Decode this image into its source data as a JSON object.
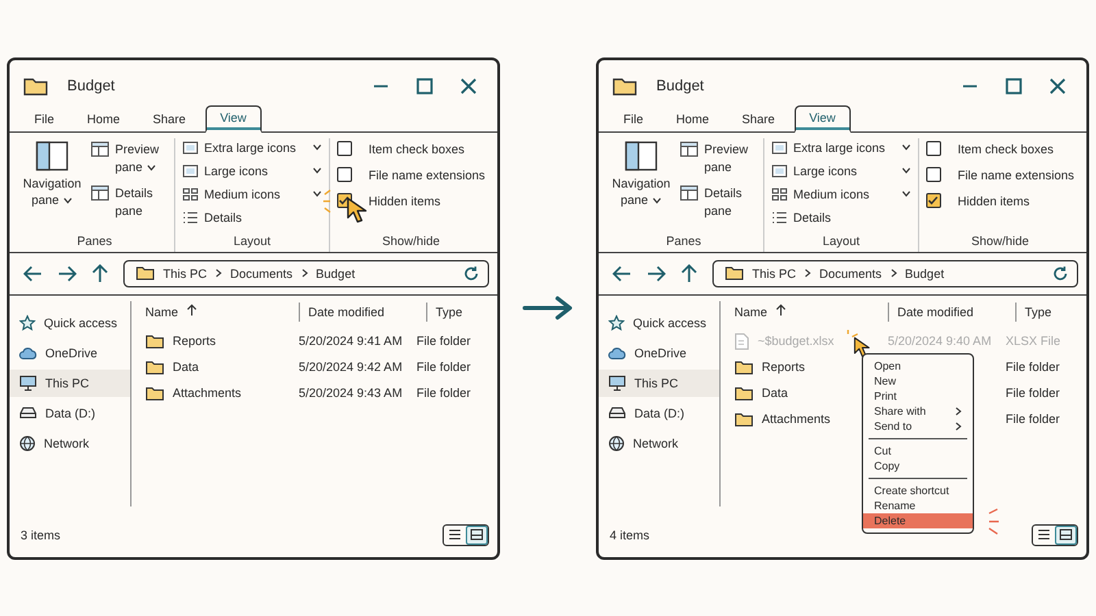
{
  "windows": [
    {
      "title": "Budget",
      "tabs": [
        {
          "label": "File",
          "selected": false
        },
        {
          "label": "Home",
          "selected": false
        },
        {
          "label": "Share",
          "selected": false
        },
        {
          "label": "View",
          "selected": true
        }
      ],
      "ribbon": {
        "panes": {
          "label": "Panes",
          "items": [
            {
              "label": "Navigation pane",
              "dropdown": true
            },
            {
              "label": "Preview pane",
              "dropdown": true
            },
            {
              "label": "Details pane",
              "dropdown": false
            }
          ]
        },
        "layout": {
          "label": "Layout",
          "items": [
            {
              "label": "Extra large icons",
              "dropdown": true
            },
            {
              "label": "Large icons",
              "dropdown": true
            },
            {
              "label": "Medium icons",
              "dropdown": true
            },
            {
              "label": "Details",
              "dropdown": false
            }
          ]
        },
        "show_hide": {
          "label": "Show/hide",
          "items": [
            {
              "label": "Item check boxes",
              "checked": false,
              "pointer": false
            },
            {
              "label": "File name extensions",
              "checked": false,
              "pointer": false
            },
            {
              "label": "Hidden items",
              "checked": true,
              "pointer": true
            }
          ]
        }
      },
      "path": [
        "This PC",
        "Documents",
        "Budget"
      ],
      "sidebar": [
        {
          "label": "Quick access",
          "selected": false
        },
        {
          "label": "OneDrive",
          "selected": false
        },
        {
          "label": "This PC",
          "selected": true
        },
        {
          "label": "Data (D:)",
          "selected": false
        },
        {
          "label": "Network",
          "selected": false
        }
      ],
      "columns": [
        {
          "label": "Name",
          "sorted": true
        },
        {
          "label": "Date modified",
          "sorted": false
        },
        {
          "label": "Type",
          "sorted": false
        }
      ],
      "files": [
        {
          "kind": "folder",
          "name": "Reports",
          "date": "5/20/2024  9:41 AM",
          "type": "File folder",
          "hidden": false,
          "pointer": false
        },
        {
          "kind": "folder",
          "name": "Data",
          "date": "5/20/2024  9:42 AM",
          "type": "File folder",
          "hidden": false,
          "pointer": false
        },
        {
          "kind": "folder",
          "name": "Attachments",
          "date": "5/20/2024  9:43 AM",
          "type": "File folder",
          "hidden": false,
          "pointer": false
        }
      ],
      "status": "3 items",
      "views": [
        {
          "selected": false
        },
        {
          "selected": true
        }
      ]
    },
    {
      "title": "Budget",
      "tabs": [
        {
          "label": "File",
          "selected": false
        },
        {
          "label": "Home",
          "selected": false
        },
        {
          "label": "Share",
          "selected": false
        },
        {
          "label": "View",
          "selected": true
        }
      ],
      "ribbon": {
        "panes": {
          "label": "Panes",
          "items": [
            {
              "label": "Navigation pane",
              "dropdown": true
            },
            {
              "label": "Preview pane",
              "dropdown": false
            },
            {
              "label": "Details pane",
              "dropdown": false
            }
          ]
        },
        "layout": {
          "label": "Layout",
          "items": [
            {
              "label": "Extra large icons",
              "dropdown": true
            },
            {
              "label": "Large icons",
              "dropdown": true
            },
            {
              "label": "Medium icons",
              "dropdown": true
            },
            {
              "label": "Details",
              "dropdown": false
            }
          ]
        },
        "show_hide": {
          "label": "Show/hide",
          "items": [
            {
              "label": "Item check boxes",
              "checked": false,
              "pointer": false
            },
            {
              "label": "File name extensions",
              "checked": false,
              "pointer": false
            },
            {
              "label": "Hidden items",
              "checked": true,
              "pointer": false
            }
          ]
        }
      },
      "path": [
        "This PC",
        "Documents",
        "Budget"
      ],
      "sidebar": [
        {
          "label": "Quick access",
          "selected": false
        },
        {
          "label": "OneDrive",
          "selected": false
        },
        {
          "label": "This PC",
          "selected": true
        },
        {
          "label": "Data (D:)",
          "selected": false
        },
        {
          "label": "Network",
          "selected": false
        }
      ],
      "columns": [
        {
          "label": "Name",
          "sorted": true
        },
        {
          "label": "Date modified",
          "sorted": false
        },
        {
          "label": "Type",
          "sorted": false
        }
      ],
      "files": [
        {
          "kind": "file",
          "name": "~$budget.xlsx",
          "date": "5/20/2024  9:40 AM",
          "type": "XLSX File",
          "hidden": true,
          "pointer": true
        },
        {
          "kind": "folder",
          "name": "Reports",
          "type": "File folder",
          "hidden": false,
          "pointer": false
        },
        {
          "kind": "folder",
          "name": "Data",
          "type": "File folder",
          "hidden": false,
          "pointer": false
        },
        {
          "kind": "folder",
          "name": "Attachments",
          "type": "File folder",
          "hidden": false,
          "pointer": false
        }
      ],
      "context_menu": {
        "groups": [
          [
            {
              "label": "Open",
              "submenu": false,
              "selected": false
            },
            {
              "label": "New",
              "submenu": false,
              "selected": false
            },
            {
              "label": "Print",
              "submenu": false,
              "selected": false
            },
            {
              "label": "Share with",
              "submenu": true,
              "selected": false
            },
            {
              "label": "Send to",
              "submenu": true,
              "selected": false
            }
          ],
          [
            {
              "label": "Cut",
              "submenu": false,
              "selected": false
            },
            {
              "label": "Copy",
              "submenu": false,
              "selected": false
            }
          ],
          [
            {
              "label": "Create shortcut",
              "submenu": false,
              "selected": false
            },
            {
              "label": "Rename",
              "submenu": false,
              "selected": false
            },
            {
              "label": "Delete",
              "submenu": false,
              "selected": true
            }
          ]
        ]
      },
      "status": "4 items",
      "views": [
        {
          "selected": false
        },
        {
          "selected": true
        }
      ]
    }
  ]
}
